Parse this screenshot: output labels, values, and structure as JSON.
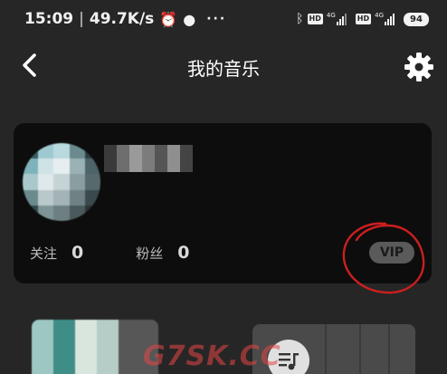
{
  "status_bar": {
    "time": "15:09",
    "separator": "|",
    "speed": "49.7K/s",
    "alarm_icon": "alarm-clock-icon",
    "app_icon": "globe-icon",
    "more_dots": "···",
    "sim1_net": "4G",
    "sim2_net": "4G",
    "hd_label": "HD",
    "battery": "94"
  },
  "header": {
    "title": "我的音乐",
    "back_icon": "chevron-left-icon",
    "settings_icon": "gear-icon"
  },
  "profile": {
    "following_label": "关注",
    "following_count": "0",
    "followers_label": "粉丝",
    "followers_count": "0",
    "vip_label": "VIP"
  },
  "watermark": "G7SK.CC",
  "colors": {
    "background": "#262626",
    "card": "#0d0d0d",
    "vip_badge": "#5a5a5a",
    "annotation": "#cc1f1f"
  }
}
